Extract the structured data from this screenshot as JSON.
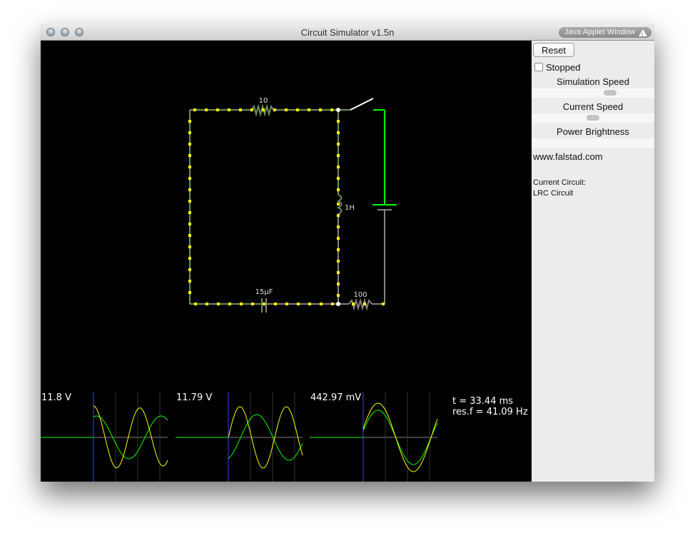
{
  "window": {
    "title": "Circuit Simulator v1.5n",
    "badge": "Java Applet Window",
    "badge_icon": "warning-icon",
    "traffic_lights": [
      "close",
      "minimize",
      "zoom"
    ]
  },
  "sidebar": {
    "reset_label": "Reset",
    "stopped_label": "Stopped",
    "stopped_checked": false,
    "sliders": [
      {
        "label": "Simulation Speed",
        "value_fraction": 0.64
      },
      {
        "label": "Current Speed",
        "value_fraction": 0.5
      },
      {
        "label": "Power Brightness",
        "value_fraction": null
      }
    ],
    "website": "www.falstad.com",
    "current_circuit_label": "Current Circuit:",
    "current_circuit_name": "LRC Circuit"
  },
  "circuit": {
    "components": [
      {
        "type": "resistor",
        "label": "10"
      },
      {
        "type": "inductor",
        "label": "1H"
      },
      {
        "type": "capacitor",
        "label": "15µF"
      },
      {
        "type": "resistor",
        "label": "100"
      },
      {
        "type": "switch",
        "state": "open"
      },
      {
        "type": "battery"
      }
    ],
    "colors": {
      "high": "#00ff00",
      "low": "#8b7f7f",
      "mid": "#6f8f5f",
      "current_dots": "#ffff00",
      "switch": "#ffffff"
    }
  },
  "scopes": [
    {
      "label": "11.8 V"
    },
    {
      "label": "11.79 V"
    },
    {
      "label": "442.97 mV"
    }
  ],
  "info": {
    "time": "t = 33.44 ms",
    "res_freq": "res.f = 41.09 Hz"
  },
  "trace_colors": {
    "voltage": "#00ff00",
    "current": "#ffff00",
    "trigger": "#4040ff",
    "axis": "#808080"
  }
}
